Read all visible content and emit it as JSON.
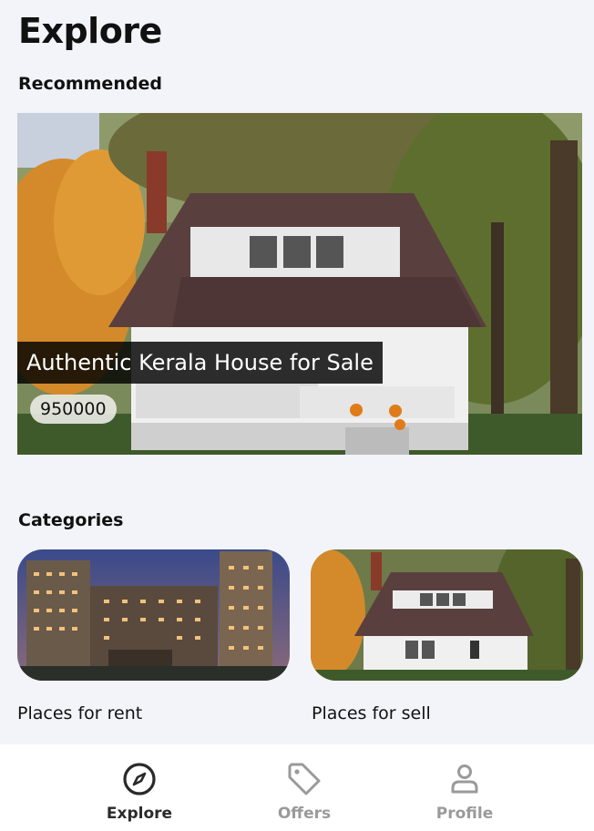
{
  "page": {
    "title": "Explore"
  },
  "recommended": {
    "section_title": "Recommended",
    "card": {
      "title": "Authentic Kerala House for Sale",
      "price": "950000"
    }
  },
  "categories": {
    "section_title": "Categories",
    "items": [
      {
        "label": "Places for rent",
        "image": "apartment-building-photo"
      },
      {
        "label": "Places for sell",
        "image": "house-photo"
      }
    ]
  },
  "bottom_nav": {
    "items": [
      {
        "label": "Explore",
        "icon": "compass-icon",
        "active": true
      },
      {
        "label": "Offers",
        "icon": "tag-icon",
        "active": false
      },
      {
        "label": "Profile",
        "icon": "person-icon",
        "active": false
      }
    ],
    "active_color": "#2a2a2a",
    "inactive_color": "#9a9a9a"
  }
}
